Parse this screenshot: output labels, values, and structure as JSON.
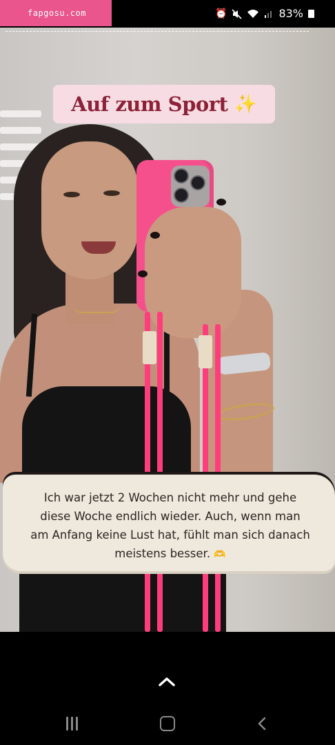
{
  "status_bar": {
    "watermark": "fapgosu.com",
    "icons": [
      "alarm-icon",
      "mute-icon",
      "wifi-icon",
      "signal-icon"
    ],
    "battery": "83%"
  },
  "story": {
    "title": "Auf zum Sport",
    "title_emoji": "✨",
    "caption": "Ich war jetzt 2 Wochen nicht mehr und gehe diese Woche endlich wieder. Auch, wenn man am Anfang keine Lust hat, fühlt man sich danach meistens besser.",
    "caption_emoji": "🫶",
    "colors": {
      "title_bg": "#f7dde3",
      "title_text": "#8c2138",
      "phone_case": "#f5508c",
      "caption_bg": "#efe8dc",
      "watermark_bg": "#e9558c"
    }
  },
  "navigation": {
    "swipe_up_icon": "chevron-up-icon",
    "buttons": [
      "recents-button",
      "home-button",
      "back-button"
    ]
  }
}
